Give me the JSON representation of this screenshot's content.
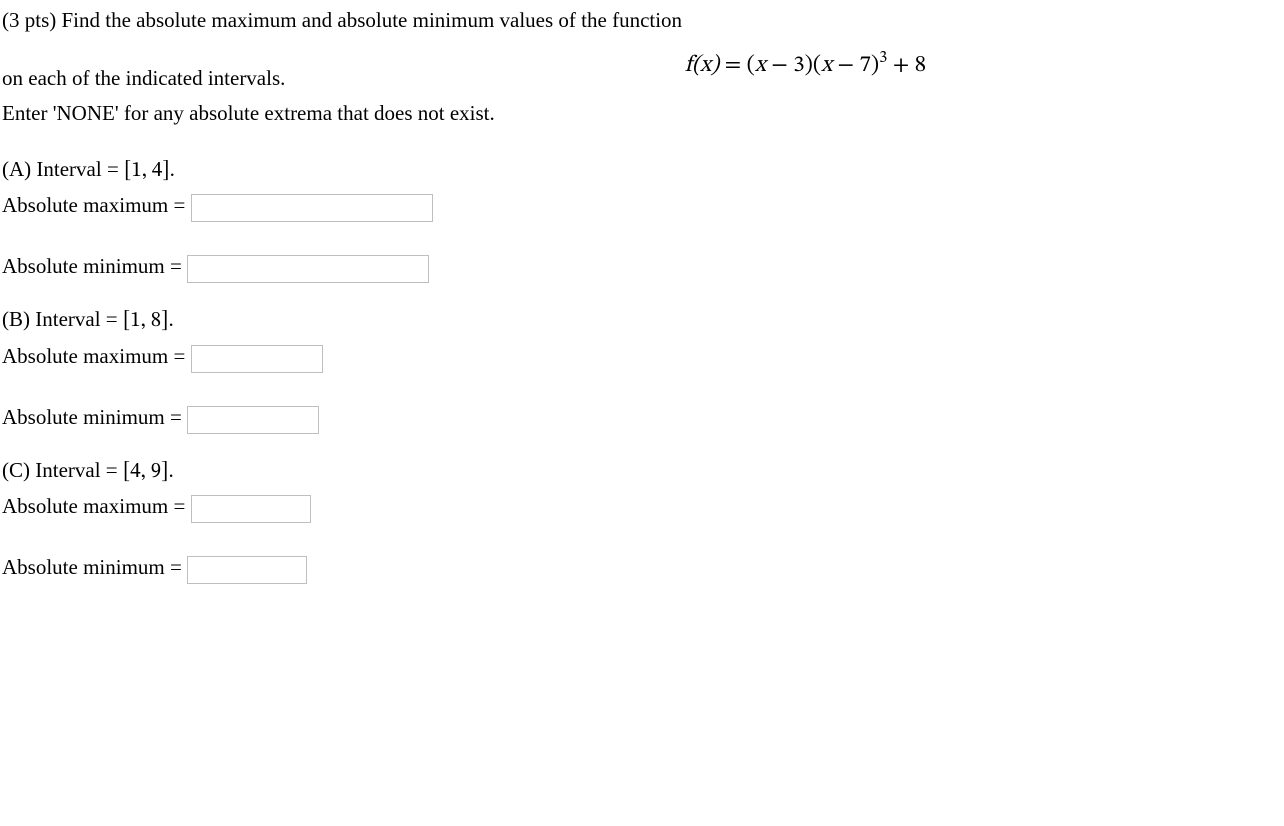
{
  "header": {
    "intro": "(3 pts) Find the absolute maximum and absolute minimum values of the function",
    "intervals_line": "on each of the indicated intervals.",
    "none_line": "Enter 'NONE' for any absolute extrema that does not exist."
  },
  "formula": {
    "f_of_x": "f(x)",
    "eq": " = ",
    "lparen1": "(",
    "x1": "x",
    "minus1": " − ",
    "c1": "3",
    "rparen1": ")",
    "lparen2": "(",
    "x2": "x",
    "minus2": " − ",
    "c2": "7",
    "rparen2": ")",
    "exp": "3",
    "plus": " + ",
    "const": "8"
  },
  "parts": {
    "A": {
      "label": "(A) Interval = ",
      "int_l": "[",
      "a": "1",
      "comma": ", ",
      "b": "4",
      "int_r": "]",
      "period": ".",
      "max_label": "Absolute maximum = ",
      "min_label": "Absolute minimum = "
    },
    "B": {
      "label": "(B) Interval = ",
      "int_l": "[",
      "a": "1",
      "comma": ", ",
      "b": "8",
      "int_r": "]",
      "period": ".",
      "max_label": "Absolute maximum = ",
      "min_label": "Absolute minimum = "
    },
    "C": {
      "label": "(C) Interval = ",
      "int_l": "[",
      "a": "4",
      "comma": ", ",
      "b": "9",
      "int_r": "]",
      "period": ".",
      "max_label": "Absolute maximum = ",
      "min_label": "Absolute minimum = "
    }
  }
}
